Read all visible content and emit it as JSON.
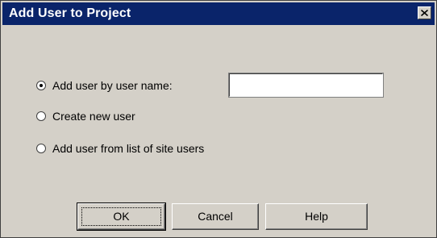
{
  "window": {
    "title": "Add User to Project",
    "close_icon": "close-icon"
  },
  "options": [
    {
      "label": "Add user by user name:",
      "selected": true
    },
    {
      "label": "Create new user",
      "selected": false
    },
    {
      "label": "Add user from list of site users",
      "selected": false
    }
  ],
  "username_input": {
    "value": "",
    "placeholder": ""
  },
  "buttons": {
    "ok_label": "OK",
    "cancel_label": "Cancel",
    "help_label": "Help"
  }
}
